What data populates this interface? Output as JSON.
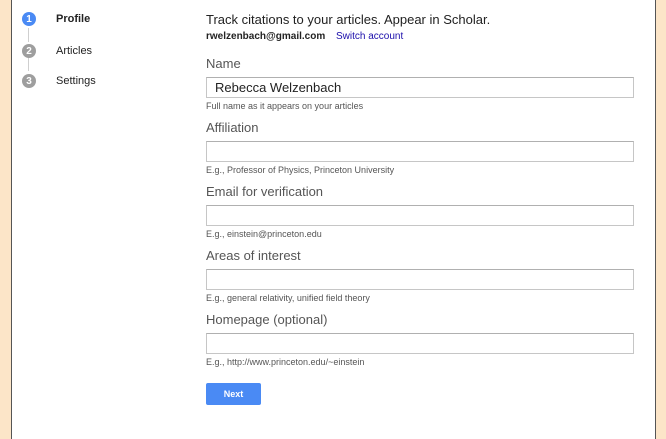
{
  "steps": [
    {
      "number": "1",
      "label": "Profile"
    },
    {
      "number": "2",
      "label": "Articles"
    },
    {
      "number": "3",
      "label": "Settings"
    }
  ],
  "header": {
    "headline": "Track citations to your articles. Appear in Scholar.",
    "email": "rwelzenbach@gmail.com",
    "switch_account": "Switch account"
  },
  "fields": {
    "name": {
      "label": "Name",
      "value": "Rebecca Welzenbach",
      "help": "Full name as it appears on your articles"
    },
    "affiliation": {
      "label": "Affiliation",
      "value": "",
      "help": "E.g., Professor of Physics, Princeton University"
    },
    "email": {
      "label": "Email for verification",
      "value": "",
      "help": "E.g., einstein@princeton.edu"
    },
    "interests": {
      "label": "Areas of interest",
      "value": "",
      "help": "E.g., general relativity, unified field theory"
    },
    "homepage": {
      "label": "Homepage (optional)",
      "value": "",
      "help": "E.g., http://www.princeton.edu/~einstein"
    }
  },
  "next_label": "Next",
  "colors": {
    "accent": "#4a8af4",
    "inactive_step": "#9e9e9e",
    "background": "#fce5c8"
  }
}
